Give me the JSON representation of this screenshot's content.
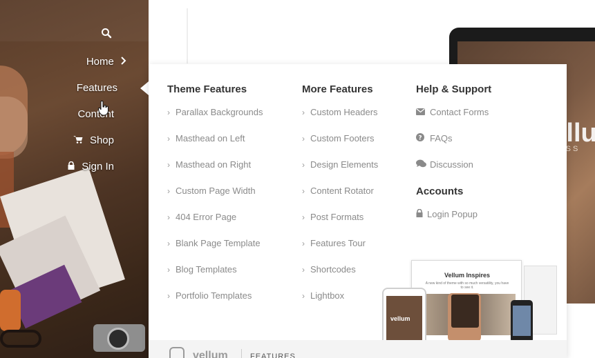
{
  "nav": {
    "items": [
      {
        "label": "Home",
        "icon": "chevron-right-icon"
      },
      {
        "label": "Features"
      },
      {
        "label": "Content"
      },
      {
        "label": "Shop",
        "icon": "cart-icon"
      },
      {
        "label": "Sign In",
        "icon": "lock-icon"
      }
    ],
    "active": "Features"
  },
  "mega_menu": {
    "columns": [
      {
        "heading": "Theme Features",
        "links": [
          "Parallax Backgrounds",
          "Masthead on Left",
          "Masthead on Right",
          "Custom Page Width",
          "404 Error Page",
          "Blank Page Template",
          "Blog Templates",
          "Portfolio Templates"
        ]
      },
      {
        "heading": "More Features",
        "links": [
          "Custom Headers",
          "Custom Footers",
          "Design Elements",
          "Content Rotator",
          "Post Formats",
          "Features Tour",
          "Shortcodes",
          "Lightbox"
        ]
      },
      {
        "heading": "Help & Support",
        "links": [
          {
            "label": "Contact Forms",
            "icon": "envelope-icon"
          },
          {
            "label": "FAQs",
            "icon": "question-circle-icon"
          },
          {
            "label": "Discussion",
            "icon": "comments-icon"
          }
        ],
        "subheading": "Accounts",
        "sublinks": [
          {
            "label": "Login Popup",
            "icon": "lock-icon"
          }
        ]
      }
    ],
    "promo": {
      "title": "Vellum Inspires",
      "subtitle": "A new kind of theme with so much versatility, you have to see it.",
      "tablet_label": "vellum"
    },
    "footer": {
      "logo": "vellum",
      "label": "FEATURES"
    }
  },
  "background": {
    "brand": "Vellu",
    "brand_sub": "PRESS"
  },
  "colors": {
    "menu_heading": "#333333",
    "menu_link": "#8a8a8a",
    "nav_text": "#ffffff"
  }
}
